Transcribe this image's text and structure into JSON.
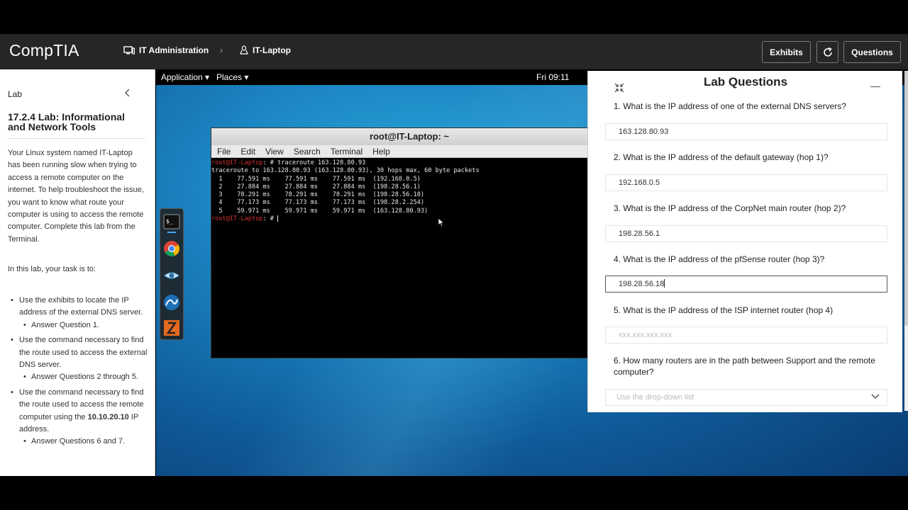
{
  "header": {
    "logo": "CompTIA",
    "breadcrumb": [
      {
        "label": "IT Administration",
        "icon": "monitor-icon"
      },
      {
        "label": "IT-Laptop",
        "icon": "linux-icon"
      }
    ],
    "separator": "›",
    "buttons": {
      "exhibits": "Exhibits",
      "questions": "Questions"
    }
  },
  "left_panel": {
    "section": "Lab",
    "title": "17.2.4 Lab: Informational and Network Tools",
    "intro": "Your Linux system named IT-Laptop has been running slow when trying to access a remote computer on the internet. To help troubleshoot the issue, you want to know what route your computer is using to access the remote computer. Complete this lab from the Terminal.",
    "task_lead": "In this lab, your task is to:",
    "tasks": [
      {
        "text": "Use the exhibits to locate the IP address of the external DNS server.",
        "sub": "Answer Question 1."
      },
      {
        "text": "Use the command necessary to find the route used to access the external DNS server.",
        "sub": "Answer Questions 2 through 5."
      },
      {
        "text_before": "Use the command necessary to find the route used to access the remote computer using the ",
        "bold": "10.10.20.10",
        "text_after": " IP address.",
        "sub": "Answer Questions 6 and 7."
      }
    ]
  },
  "desktop": {
    "menu": {
      "application": "Application ▾",
      "places": "Places ▾",
      "clock": "Fri 09:11"
    },
    "terminal": {
      "title": "root@IT-Laptop: ~",
      "menu": [
        "File",
        "Edit",
        "View",
        "Search",
        "Terminal",
        "Help"
      ],
      "prompt": "root@IT-Laptop",
      "command": ": # traceroute 163.128.80.93",
      "header_line": "traceroute to 163.128.80.93 (163.128.80.93), 30 hops max, 60 byte packets",
      "hops": [
        "  1    77.591 ms    77.591 ms    77.591 ms  (192.168.0.5)",
        "  2    27.884 ms    27.884 ms    27.884 ms  (198.28.56.1)",
        "  3    78.291 ms    78.291 ms    78.291 ms  (198.28.56.18)",
        "  4    77.173 ms    77.173 ms    77.173 ms  (198.28.2.254)",
        "  5    59.971 ms    59.971 ms    59.971 ms  (163.128.80.93)"
      ],
      "prompt_end": ": # "
    }
  },
  "questions_panel": {
    "title": "Lab Questions",
    "questions": [
      {
        "label": "1. What is the IP address of one of the external DNS servers?",
        "value": "163.128.80.93"
      },
      {
        "label": "2. What is the IP address of the default gateway (hop 1)?",
        "value": "192.168.0.5"
      },
      {
        "label": "3. What is the IP address of the CorpNet main router (hop 2)?",
        "value": "198.28.56.1"
      },
      {
        "label": "4. What is the IP address of the pfSense router (hop 3)?",
        "value": "198.28.56.18"
      },
      {
        "label": "5. What is the IP address of the ISP internet router (hop 4)",
        "placeholder": "xxx.xxx.xxx.xxx"
      },
      {
        "label": "6. How many routers are in the path between Support and the remote computer?",
        "placeholder": "Use the drop-down list"
      }
    ]
  }
}
